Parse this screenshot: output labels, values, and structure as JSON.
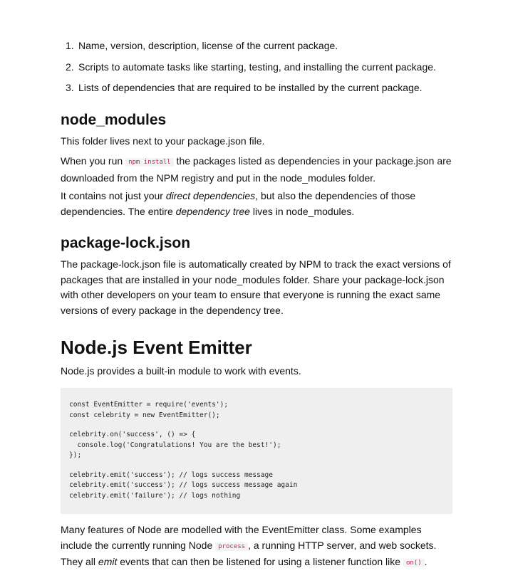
{
  "list": [
    {
      "num": "1.",
      "text": "Name, version, description, license of the current package."
    },
    {
      "num": "2.",
      "text": "Scripts to automate tasks like starting, testing, and installing the current package."
    },
    {
      "num": "3.",
      "text": "Lists of dependencies that are required to be installed by the current package."
    }
  ],
  "node_modules": {
    "heading": "node_modules",
    "p1": "This folder lives next to your package.json file.",
    "p2_before": "When you run ",
    "p2_code": "npm install",
    "p2_after": " the packages listed as dependencies in your package.json are downloaded from the NPM registry and put in the node_modules folder.",
    "p3_a": "It contains not just your ",
    "p3_em1": "direct dependencies",
    "p3_b": ", but also the dependencies of those dependencies. The entire ",
    "p3_em2": "dependency tree",
    "p3_c": " lives in node_modules."
  },
  "package_lock": {
    "heading": "package-lock.json",
    "p1": "The package-lock.json file is automatically created by NPM to track the exact versions of packages that are installed in your node_modules folder. Share your package-lock.json with other developers on your team to ensure that everyone is running the exact same versions of every package in the dependency tree."
  },
  "event_emitter": {
    "heading": "Node.js Event Emitter",
    "intro": "Node.js provides a built-in module to work with events.",
    "code_groups": [
      [
        "const EventEmitter = require('events');",
        "const celebrity = new EventEmitter();"
      ],
      [
        "celebrity.on('success', () => {",
        "  console.log('Congratulations! You are the best!');",
        "});"
      ],
      [
        "celebrity.emit('success'); // logs success message",
        "celebrity.emit('success'); // logs success message again",
        "celebrity.emit('failure'); // logs nothing"
      ]
    ],
    "p_a": "Many features of Node are modelled with the EventEmitter class. Some examples include the currently running Node ",
    "p_code1": "process",
    "p_b": ", a running HTTP server, and web sockets. They all ",
    "p_em": "emit",
    "p_c": " events that can then be listened for using a listener function like ",
    "p_code2": "on()",
    "p_d": "."
  }
}
